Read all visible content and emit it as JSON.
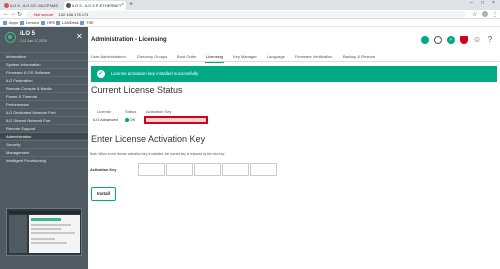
{
  "browser": {
    "tabs": [
      {
        "label": "iLO 5 - iLO CE: MLCPXMS",
        "fav": "#d9534f",
        "active": false
      },
      {
        "label": "iLO 5 - iLO 5 P-ETHERNET",
        "fav": "#555555",
        "active": true
      }
    ],
    "url": "192.168.178.174",
    "url_prefix": "Not secure",
    "bookmarks": [
      "Apps",
      "Lenovo",
      "HPE",
      "LANDesk",
      "TSE"
    ]
  },
  "sidebar": {
    "product": "iLO 5",
    "version": "1.11 Jan 17 2020",
    "items": [
      {
        "label": "Information",
        "active": false
      },
      {
        "label": "System Information",
        "active": false
      },
      {
        "label": "Firmware & OS Software",
        "active": false
      },
      {
        "label": "iLO Federation",
        "active": false
      },
      {
        "label": "Remote Console & Media",
        "active": false
      },
      {
        "label": "Power & Thermal",
        "active": false
      },
      {
        "label": "Performance",
        "active": false
      },
      {
        "label": "iLO Dedicated Network Port",
        "active": false
      },
      {
        "label": "iLO Shared Network Port",
        "active": false
      },
      {
        "label": "Remote Support",
        "active": false
      },
      {
        "label": "Administration",
        "active": true
      },
      {
        "label": "Security",
        "active": false
      },
      {
        "label": "Management",
        "active": false
      },
      {
        "label": "Intelligent Provisioning",
        "active": false
      }
    ]
  },
  "header": {
    "title": "Administration - Licensing",
    "icons": [
      {
        "name": "health-status-icon",
        "color": "#01a982"
      },
      {
        "name": "power-icon",
        "color": "#555555"
      },
      {
        "name": "uid-icon",
        "color": "#01a982"
      },
      {
        "name": "security-shield-icon",
        "color": "#d0021b"
      },
      {
        "name": "user-icon",
        "color": "#555555"
      },
      {
        "name": "help-icon",
        "color": "#555555"
      }
    ],
    "help_glyph": "?",
    "user_glyph": "☺"
  },
  "tabs": [
    {
      "label": "User Administration",
      "active": false
    },
    {
      "label": "Directory Groups",
      "active": false
    },
    {
      "label": "Boot Order",
      "active": false
    },
    {
      "label": "Licensing",
      "active": true
    },
    {
      "label": "Key Manager",
      "active": false
    },
    {
      "label": "Language",
      "active": false
    },
    {
      "label": "Firmware Verification",
      "active": false
    },
    {
      "label": "Backup & Restore",
      "active": false
    }
  ],
  "banner": {
    "message": "License activation key installed successfully"
  },
  "current_status": {
    "heading": "Current License Status",
    "columns": [
      "License",
      "Status",
      "Activation Key"
    ],
    "row": {
      "license": "iLO Advanced",
      "status": "OK",
      "activation_key": ""
    }
  },
  "activation": {
    "heading": "Enter License Activation Key",
    "note": "Note: When a new license activation key is installed, the current key is replaced by the new key.",
    "field_label": "Activation Key",
    "key_segments": [
      "",
      "",
      "",
      "",
      ""
    ],
    "install_label": "Install"
  }
}
